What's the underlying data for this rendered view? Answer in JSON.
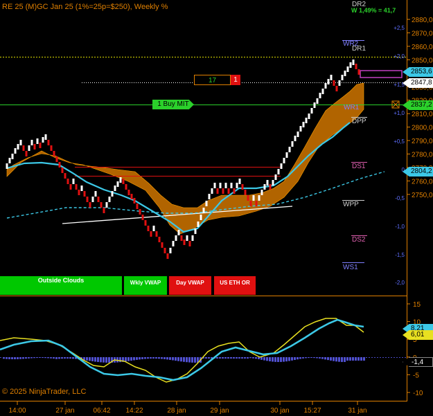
{
  "header": {
    "title": "RE 25 (M)GC Jan 25 (1%=25p=$250), Weekly %"
  },
  "footer": {
    "copyright": "© 2025 NinjaTrader, LLC"
  },
  "colors": {
    "axis": "#e08000",
    "bull": "#ffffff",
    "bear": "#e01010",
    "cloud": "#d27a00",
    "vwap": "#3cc8e6",
    "green": "#2bd12b",
    "magenta": "#c0409a"
  },
  "order": {
    "quantity": "17",
    "cancel": "1",
    "buy_label": "1 Buy MIT"
  },
  "buttons": {
    "outside_clouds": "Outside Clouds",
    "wkly_vwap": "Wkly VWAP",
    "day_vwap": "Day VWAP",
    "us_eth_or": "US ETH OR"
  },
  "price_axis": {
    "ticks": [
      "2880,0",
      "2870,0",
      "2860,0",
      "2850,0",
      "2840,0",
      "2830,0",
      "2820,0",
      "2810,0",
      "2800,0",
      "2790,0",
      "2780,0",
      "2770,0",
      "2760,0",
      "2750,0"
    ],
    "tags": {
      "vwap": "2853,6",
      "last": "2847,8",
      "buy_mit": "2837,2",
      "wk_vwap": "2804,2"
    }
  },
  "pct_axis": {
    "ticks": [
      "+2,5",
      "+2,0",
      "+1,5",
      "+1,0",
      "+0,5",
      "0",
      "-0,5",
      "-1,0",
      "-1,5",
      "-2,0"
    ]
  },
  "levels": {
    "dr2": "DR2",
    "weekly_pct": "W 1,49% = 41,7",
    "wr2": "WR2",
    "dr1": "DR1",
    "wr1": "WR1",
    "dpp": "DPP",
    "ds1": "DS1",
    "wpp": "WPP",
    "ds2": "DS2",
    "ws1": "WS1"
  },
  "osc_axis": {
    "ticks": [
      "15",
      "10",
      "5",
      "0",
      "-5",
      "-10"
    ],
    "tags": {
      "blue": "8,21",
      "yellow": "6,01",
      "hist": "-1,4"
    }
  },
  "time_axis": {
    "labels": [
      "14:00",
      "27 jan",
      "06:42",
      "14:22",
      "28 jan",
      "29 jan",
      "30 jan",
      "15:27",
      "31 jan"
    ]
  }
}
